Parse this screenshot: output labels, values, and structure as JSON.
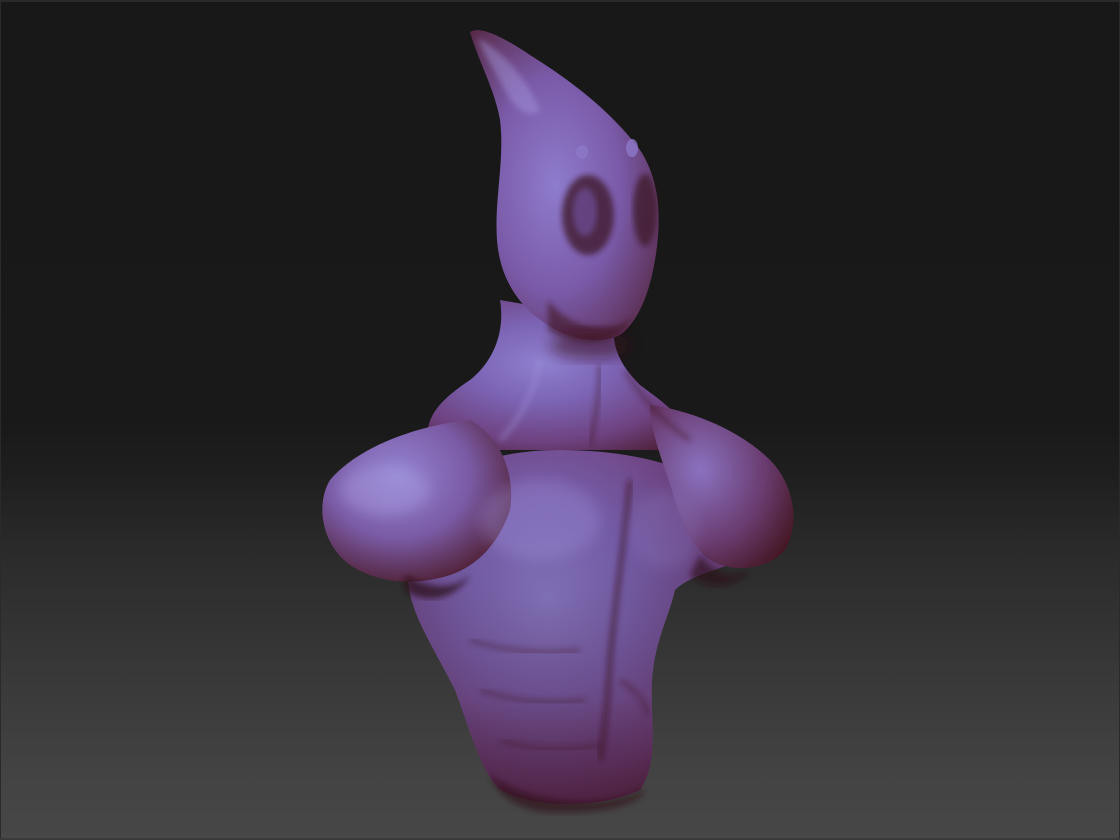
{
  "viewport": {
    "background_top": "#181818",
    "background_bottom": "#474747"
  },
  "sculpt": {
    "icon": "alien-bust-sculpt",
    "material_highlight": "#8a78c8",
    "material_base": "#7a4a78",
    "material_shadow": "#4a1e2a"
  }
}
